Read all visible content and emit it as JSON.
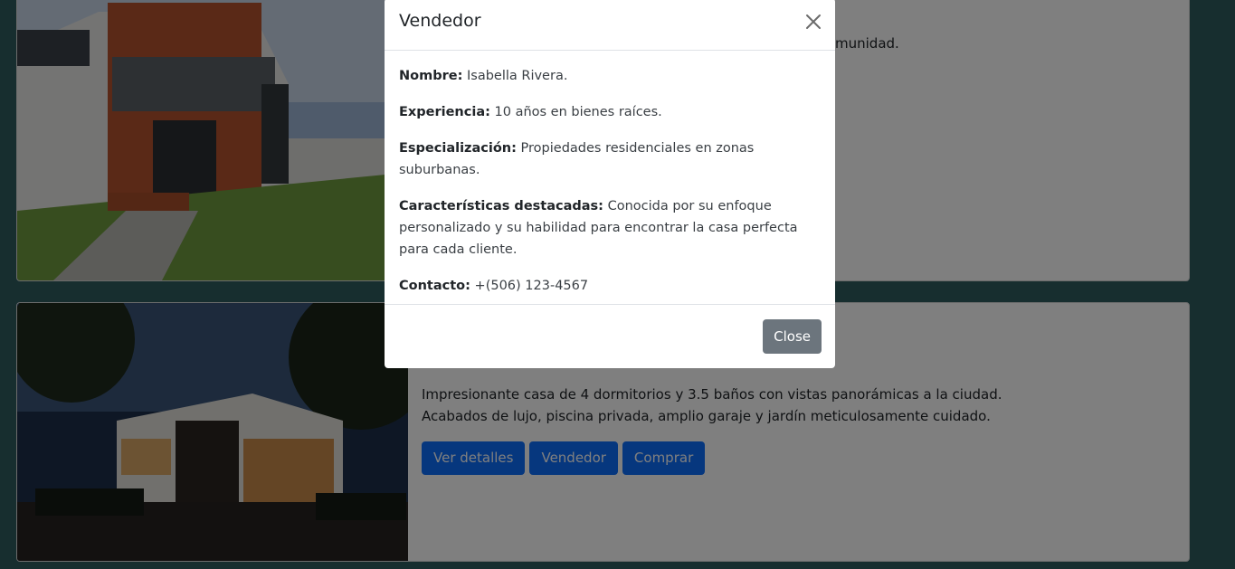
{
  "listings": [
    {
      "description_fragment": "munidad.",
      "image_alt_icon": "modern-house-photo"
    },
    {
      "description_line1": "Impresionante casa de 4 dormitorios y 3.5 baños con vistas panorámicas a la ciudad.",
      "description_line2": "Acabados de lujo, piscina privada, amplio garaje y jardín meticulosamente cuidado.",
      "image_alt_icon": "night-house-photo",
      "buttons": {
        "details": "Ver detalles",
        "seller": "Vendedor",
        "buy": "Comprar"
      }
    }
  ],
  "modal": {
    "title": "Vendedor",
    "close_icon": "close-icon",
    "fields": {
      "name_label": "Nombre:",
      "name_value": "Isabella Rivera.",
      "experience_label": "Experiencia:",
      "experience_value": "10 años en bienes raíces.",
      "specialization_label": "Especialización:",
      "specialization_value": "Propiedades residenciales en zonas suburbanas.",
      "features_label": "Características destacadas:",
      "features_value": "Conocida por su enfoque personalizado y su habilidad para encontrar la casa perfecta para cada cliente.",
      "contact_label": "Contacto:",
      "contact_value": "+(506) 123-4567"
    },
    "close_button": "Close"
  },
  "colors": {
    "page_background": "#2f5d5e",
    "primary_button": "#0d6efd",
    "secondary_button": "#6c757d"
  }
}
